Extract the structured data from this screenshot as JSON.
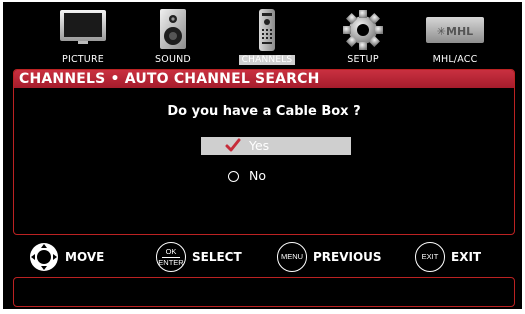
{
  "menu": {
    "items": [
      {
        "label": "PICTURE",
        "icon": "picture-icon"
      },
      {
        "label": "SOUND",
        "icon": "sound-icon"
      },
      {
        "label": "CHANNELS",
        "icon": "remote-icon",
        "active": true
      },
      {
        "label": "SETUP",
        "icon": "gear-icon"
      },
      {
        "label": "MHL/ACC",
        "icon": "mhl-logo-icon",
        "logo_text": "MHL"
      }
    ]
  },
  "panel": {
    "title": "CHANNELS • AUTO CHANNEL SEARCH",
    "question": "Do you have a Cable Box ?",
    "options": [
      {
        "label": "Yes",
        "selected": true,
        "mark": "✔"
      },
      {
        "label": "No",
        "selected": false
      }
    ]
  },
  "controls": [
    {
      "button": "",
      "label": "MOVE",
      "icon": "dpad-icon"
    },
    {
      "button_top": "OK",
      "button_bottom": "ENTER",
      "label": "SELECT"
    },
    {
      "button": "MENU",
      "label": "PREVIOUS"
    },
    {
      "button": "EXIT",
      "label": "EXIT"
    }
  ],
  "colors": {
    "accent": "#b7202e",
    "background": "#000000",
    "highlight": "#cfcfcf",
    "check": "#c62c3a"
  }
}
